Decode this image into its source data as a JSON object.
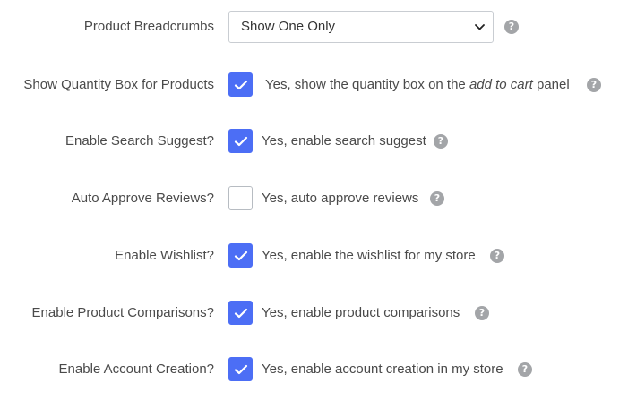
{
  "settings": {
    "breadcrumbs": {
      "label": "Product Breadcrumbs",
      "selected": "Show One Only",
      "help": "?"
    },
    "quantity_box": {
      "label": "Show Quantity Box for Products",
      "checked": true,
      "text_before": "Yes, show the quantity box on the ",
      "text_emphasis": "add to cart",
      "text_after": " panel",
      "help": "?"
    },
    "search_suggest": {
      "label": "Enable Search Suggest?",
      "checked": true,
      "text": "Yes, enable search suggest",
      "help": "?"
    },
    "auto_approve": {
      "label": "Auto Approve Reviews?",
      "checked": false,
      "text": "Yes, auto approve reviews",
      "help": "?"
    },
    "wishlist": {
      "label": "Enable Wishlist?",
      "checked": true,
      "text": "Yes, enable the wishlist for my store",
      "help": "?"
    },
    "comparisons": {
      "label": "Enable Product Comparisons?",
      "checked": true,
      "text": "Yes, enable product comparisons",
      "help": "?"
    },
    "account_creation": {
      "label": "Enable Account Creation?",
      "checked": true,
      "text": "Yes, enable account creation in my store",
      "help": "?"
    }
  },
  "colors": {
    "checkbox_checked": "#4c6ef5",
    "help_icon": "#a3a5a8"
  },
  "icons": {
    "checkbox": "checkmark-icon",
    "help": "question-circle-icon",
    "select": "chevron-down-icon"
  }
}
